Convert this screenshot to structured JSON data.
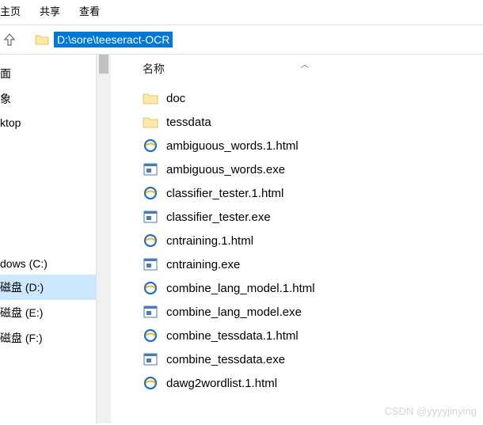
{
  "ribbon": {
    "tab1": "主页",
    "tab2": "共享",
    "tab3": "查看"
  },
  "address": {
    "path": "D:\\sore\\teeseract-OCR"
  },
  "nav": {
    "items": [
      "面",
      "象",
      "ktop"
    ],
    "drives": [
      {
        "label": "dows (C:)",
        "selected": false
      },
      {
        "label": "磁盘 (D:)",
        "selected": true
      },
      {
        "label": "磁盘 (E:)",
        "selected": false
      },
      {
        "label": "磁盘 (F:)",
        "selected": false
      }
    ]
  },
  "columns": {
    "name": "名称"
  },
  "files": [
    {
      "name": "doc",
      "icon": "folder"
    },
    {
      "name": "tessdata",
      "icon": "folder"
    },
    {
      "name": "ambiguous_words.1.html",
      "icon": "ie"
    },
    {
      "name": "ambiguous_words.exe",
      "icon": "exe"
    },
    {
      "name": "classifier_tester.1.html",
      "icon": "ie"
    },
    {
      "name": "classifier_tester.exe",
      "icon": "exe"
    },
    {
      "name": "cntraining.1.html",
      "icon": "ie"
    },
    {
      "name": "cntraining.exe",
      "icon": "exe"
    },
    {
      "name": "combine_lang_model.1.html",
      "icon": "ie"
    },
    {
      "name": "combine_lang_model.exe",
      "icon": "exe"
    },
    {
      "name": "combine_tessdata.1.html",
      "icon": "ie"
    },
    {
      "name": "combine_tessdata.exe",
      "icon": "exe"
    },
    {
      "name": "dawg2wordlist.1.html",
      "icon": "ie"
    }
  ],
  "watermark": "CSDN @yyyyjinying"
}
